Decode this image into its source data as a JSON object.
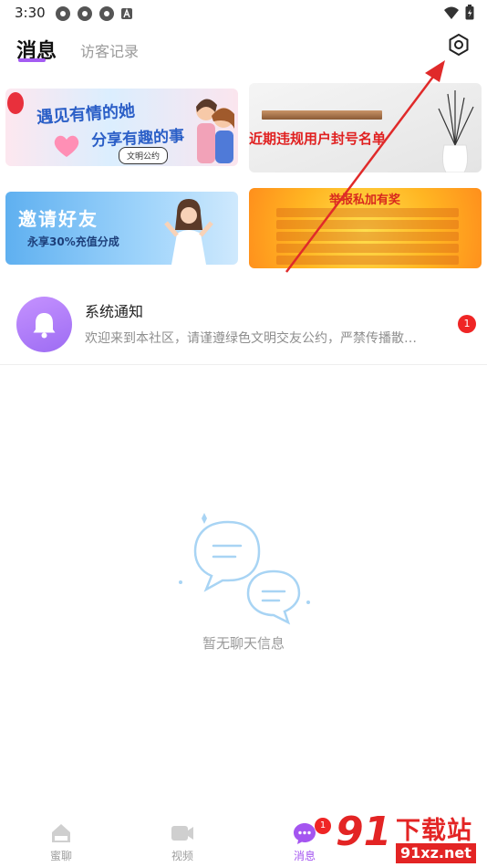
{
  "status_bar": {
    "time": "3:30",
    "left_icons": [
      "app-icon",
      "app-icon",
      "app-icon",
      "a-notification-icon"
    ],
    "right_icons": [
      "wifi-icon",
      "battery-charging-icon"
    ]
  },
  "header": {
    "tabs": [
      {
        "label": "消息",
        "active": true
      },
      {
        "label": "访客记录",
        "active": false
      }
    ],
    "settings_icon": "settings-hexagon-icon",
    "accent_color": "#a45cf2"
  },
  "banners": [
    {
      "line1": "遇见有情的她",
      "line2": "分享有趣的事",
      "button": "文明公约"
    },
    {
      "title": "近期违规用户封号名单"
    },
    {
      "title": "邀请好友",
      "subtitle": "永享30%充值分成"
    },
    {
      "title": "举报私加有奖"
    }
  ],
  "notification": {
    "title": "系统通知",
    "preview": "欢迎来到本社区，请谨遵绿色文明交友公约，严禁传播散…",
    "badge": "1",
    "icon": "bell-icon"
  },
  "empty_state": {
    "text": "暂无聊天信息",
    "icon": "chat-bubbles-icon"
  },
  "bottom_nav": {
    "items": [
      {
        "label": "蜜聊",
        "icon": "home-icon",
        "active": false
      },
      {
        "label": "视频",
        "icon": "video-icon",
        "active": false
      },
      {
        "label": "消息",
        "icon": "message-icon",
        "active": true,
        "badge": "1"
      }
    ]
  },
  "watermark": {
    "brand": "91",
    "text": "下载站",
    "url": "91xz.net"
  },
  "annotation": {
    "arrow_color": "#e02a2a"
  }
}
